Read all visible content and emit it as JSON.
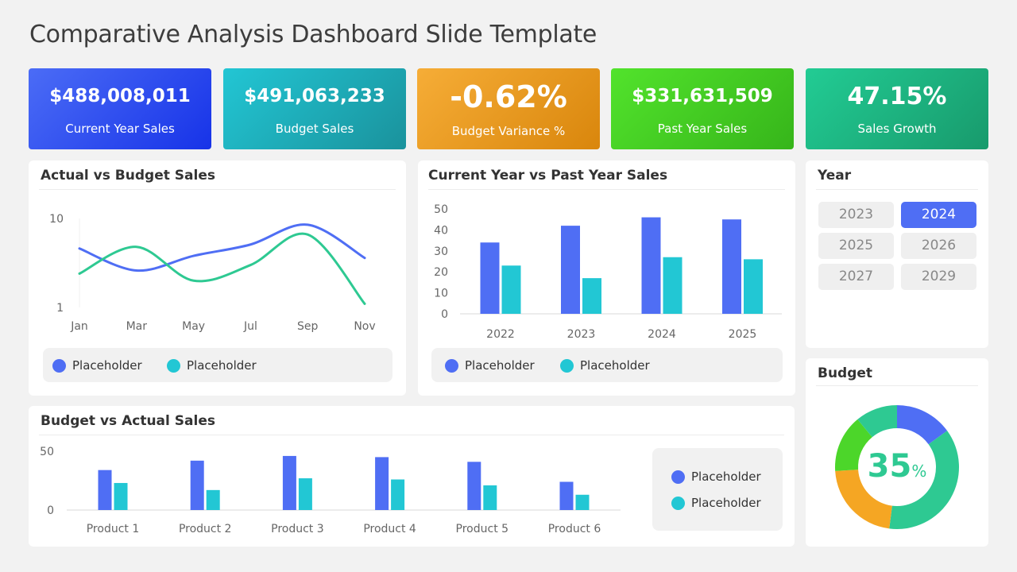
{
  "title": "Comparative Analysis Dashboard Slide Template",
  "colors": {
    "blue": "#4f6ef4",
    "cyan": "#22c7d4",
    "green": "#2ec992",
    "orange": "#f5a623",
    "lime": "#4cd62a"
  },
  "kpis": [
    {
      "value": "$488,008,011",
      "label": "Current Year Sales"
    },
    {
      "value": "$491,063,233",
      "label": "Budget Sales"
    },
    {
      "value": "-0.62%",
      "label": "Budget Variance %"
    },
    {
      "value": "$331,631,509",
      "label": "Past Year Sales"
    },
    {
      "value": "47.15%",
      "label": "Sales Growth"
    }
  ],
  "cards": {
    "line_title": "Actual vs Budget Sales",
    "cy_title": "Current Year vs Past Year Sales",
    "year_title": "Year",
    "budget_title": "Budget",
    "prod_title": "Budget vs Actual Sales"
  },
  "legends": {
    "line": [
      "Placeholder",
      "Placeholder"
    ],
    "cy": [
      "Placeholder",
      "Placeholder"
    ],
    "prod": [
      "Placeholder",
      "Placeholder"
    ]
  },
  "years": {
    "options": [
      "2023",
      "2024",
      "2025",
      "2026",
      "2027",
      "2029"
    ],
    "selected": "2024"
  },
  "donut": {
    "center_value": "35",
    "center_unit": "%"
  },
  "chart_data": [
    {
      "type": "line",
      "title": "Actual vs Budget Sales",
      "x": [
        "Jan",
        "Mar",
        "May",
        "Jul",
        "Sep",
        "Nov"
      ],
      "yscale": "log",
      "ylim": [
        1,
        10
      ],
      "yticks": [
        "10",
        "1"
      ],
      "series": [
        {
          "name": "Placeholder",
          "color": "#4f6ef4",
          "values": [
            4.6,
            2.6,
            3.8,
            5.1,
            8.5,
            3.6
          ]
        },
        {
          "name": "Placeholder",
          "color": "#2ec992",
          "values": [
            2.4,
            4.8,
            2.0,
            3.0,
            6.6,
            1.1
          ]
        }
      ]
    },
    {
      "type": "bar",
      "title": "Current Year vs Past Year Sales",
      "categories": [
        "2022",
        "2023",
        "2024",
        "2025"
      ],
      "ylim": [
        0,
        50
      ],
      "yticks": [
        "0",
        "10",
        "20",
        "30",
        "40",
        "50"
      ],
      "series": [
        {
          "name": "Placeholder",
          "color": "#4f6ef4",
          "values": [
            34,
            42,
            46,
            45
          ]
        },
        {
          "name": "Placeholder",
          "color": "#22c7d4",
          "values": [
            23,
            17,
            27,
            26
          ]
        }
      ]
    },
    {
      "type": "bar",
      "title": "Budget vs Actual Sales",
      "categories": [
        "Product 1",
        "Product 2",
        "Product 3",
        "Product 4",
        "Product 5",
        "Product 6"
      ],
      "ylim": [
        0,
        50
      ],
      "yticks": [
        "0",
        "50"
      ],
      "series": [
        {
          "name": "Placeholder",
          "color": "#4f6ef4",
          "values": [
            34,
            42,
            46,
            45,
            41,
            24
          ]
        },
        {
          "name": "Placeholder",
          "color": "#22c7d4",
          "values": [
            23,
            17,
            27,
            26,
            21,
            13
          ]
        }
      ]
    },
    {
      "type": "pie",
      "title": "Budget",
      "center_label": "35%",
      "slices": [
        {
          "color": "#4f6ef4",
          "value": 15
        },
        {
          "color": "#2ec992",
          "value": 37
        },
        {
          "color": "#f5a623",
          "value": 22
        },
        {
          "color": "#4cd62a",
          "value": 15
        },
        {
          "color": "#2ec992",
          "value": 11
        }
      ]
    }
  ]
}
